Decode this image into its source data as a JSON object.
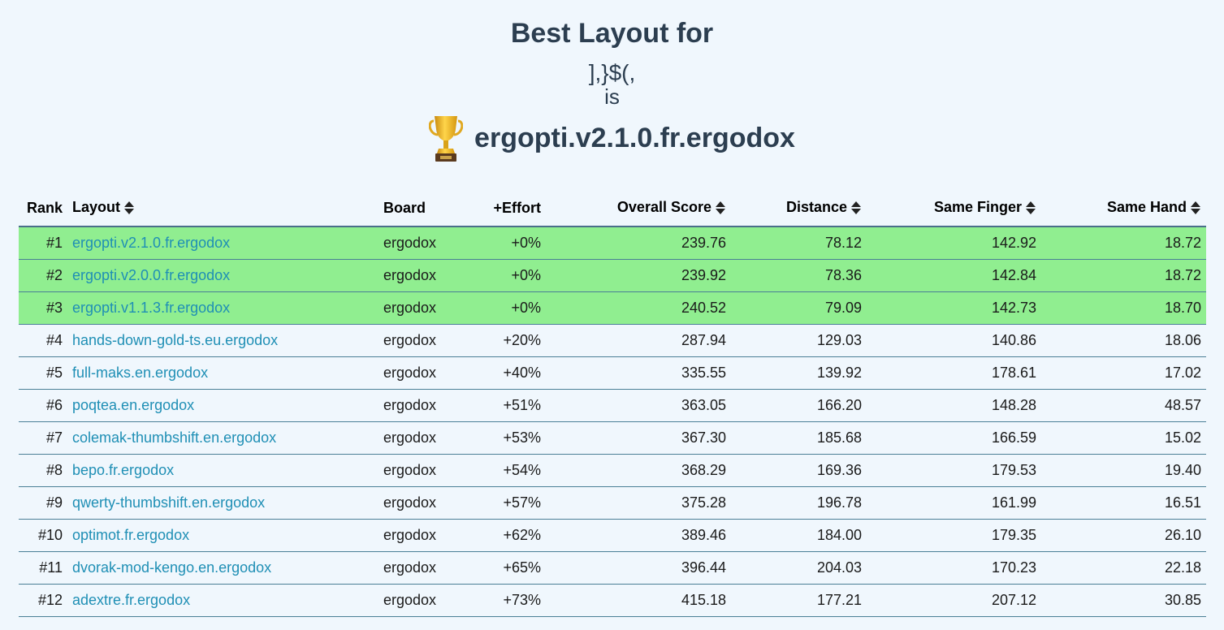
{
  "header": {
    "title": "Best Layout for",
    "chars": "],}$(,",
    "is_word": "is",
    "winner": "ergopti.v2.1.0.fr.ergodox",
    "winner_icon": "trophy-icon"
  },
  "table": {
    "columns": {
      "rank": "Rank",
      "layout": "Layout",
      "board": "Board",
      "effort": "+Effort",
      "overall": "Overall Score",
      "distance": "Distance",
      "same_finger": "Same Finger",
      "same_hand": "Same Hand"
    },
    "sort_icon": "sort-arrows-icon",
    "highlight_color": "#90ee90",
    "link_color": "#1f8fb5",
    "rows": [
      {
        "rank": "#1",
        "layout": "ergopti.v2.1.0.fr.ergodox",
        "board": "ergodox",
        "effort": "+0%",
        "overall": "239.76",
        "distance": "78.12",
        "same_finger": "142.92",
        "same_hand": "18.72",
        "highlight": true
      },
      {
        "rank": "#2",
        "layout": "ergopti.v2.0.0.fr.ergodox",
        "board": "ergodox",
        "effort": "+0%",
        "overall": "239.92",
        "distance": "78.36",
        "same_finger": "142.84",
        "same_hand": "18.72",
        "highlight": true
      },
      {
        "rank": "#3",
        "layout": "ergopti.v1.1.3.fr.ergodox",
        "board": "ergodox",
        "effort": "+0%",
        "overall": "240.52",
        "distance": "79.09",
        "same_finger": "142.73",
        "same_hand": "18.70",
        "highlight": true
      },
      {
        "rank": "#4",
        "layout": "hands-down-gold-ts.eu.ergodox",
        "board": "ergodox",
        "effort": "+20%",
        "overall": "287.94",
        "distance": "129.03",
        "same_finger": "140.86",
        "same_hand": "18.06",
        "highlight": false
      },
      {
        "rank": "#5",
        "layout": "full-maks.en.ergodox",
        "board": "ergodox",
        "effort": "+40%",
        "overall": "335.55",
        "distance": "139.92",
        "same_finger": "178.61",
        "same_hand": "17.02",
        "highlight": false
      },
      {
        "rank": "#6",
        "layout": "poqtea.en.ergodox",
        "board": "ergodox",
        "effort": "+51%",
        "overall": "363.05",
        "distance": "166.20",
        "same_finger": "148.28",
        "same_hand": "48.57",
        "highlight": false
      },
      {
        "rank": "#7",
        "layout": "colemak-thumbshift.en.ergodox",
        "board": "ergodox",
        "effort": "+53%",
        "overall": "367.30",
        "distance": "185.68",
        "same_finger": "166.59",
        "same_hand": "15.02",
        "highlight": false
      },
      {
        "rank": "#8",
        "layout": "bepo.fr.ergodox",
        "board": "ergodox",
        "effort": "+54%",
        "overall": "368.29",
        "distance": "169.36",
        "same_finger": "179.53",
        "same_hand": "19.40",
        "highlight": false
      },
      {
        "rank": "#9",
        "layout": "qwerty-thumbshift.en.ergodox",
        "board": "ergodox",
        "effort": "+57%",
        "overall": "375.28",
        "distance": "196.78",
        "same_finger": "161.99",
        "same_hand": "16.51",
        "highlight": false
      },
      {
        "rank": "#10",
        "layout": "optimot.fr.ergodox",
        "board": "ergodox",
        "effort": "+62%",
        "overall": "389.46",
        "distance": "184.00",
        "same_finger": "179.35",
        "same_hand": "26.10",
        "highlight": false
      },
      {
        "rank": "#11",
        "layout": "dvorak-mod-kengo.en.ergodox",
        "board": "ergodox",
        "effort": "+65%",
        "overall": "396.44",
        "distance": "204.03",
        "same_finger": "170.23",
        "same_hand": "22.18",
        "highlight": false
      },
      {
        "rank": "#12",
        "layout": "adextre.fr.ergodox",
        "board": "ergodox",
        "effort": "+73%",
        "overall": "415.18",
        "distance": "177.21",
        "same_finger": "207.12",
        "same_hand": "30.85",
        "highlight": false
      }
    ]
  }
}
